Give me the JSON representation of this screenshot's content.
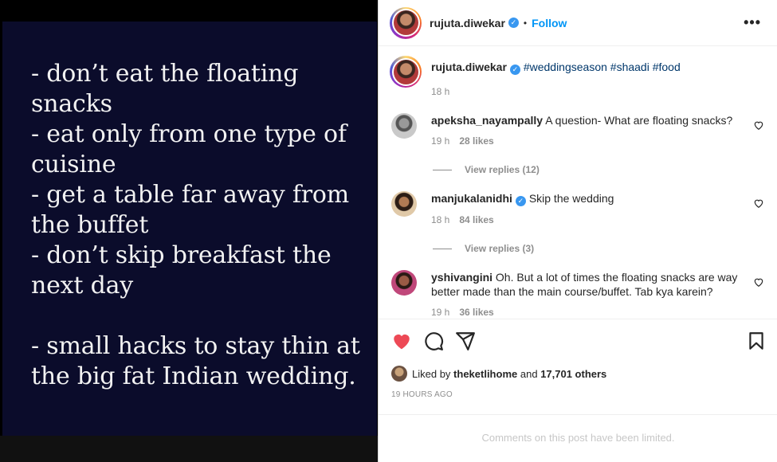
{
  "post_image": {
    "lines": "- don’t eat the floating\nsnacks\n- eat only from one type of\ncuisine\n- get a table far away from\nthe buffet\n- don’t skip breakfast the\nnext day\n\n- small hacks to stay thin at\nthe big fat Indian wedding."
  },
  "header": {
    "username": "rujuta.diwekar",
    "dot": "•",
    "follow_label": "Follow",
    "more_label": "•••"
  },
  "caption": {
    "username": "rujuta.diwekar",
    "text": "#weddingseason #shaadi #food",
    "time": "18 h"
  },
  "comments": [
    {
      "username": "apeksha_nayampally",
      "text": "A question- What are floating snacks?",
      "time": "19 h",
      "likes": "28 likes",
      "replies": "View replies (12)"
    },
    {
      "username": "manjukalanidhi",
      "text": "Skip the wedding",
      "time": "18 h",
      "likes": "84 likes",
      "replies": "View replies (3)"
    },
    {
      "username": "yshivangini",
      "text": "Oh. But a lot of times the floating snacks are way better made than the main course/buffet. Tab kya karein?",
      "time": "19 h",
      "likes": "36 likes"
    }
  ],
  "likes": {
    "prefix": "Liked by",
    "user": "theketlihome",
    "and": "and",
    "count": "17,701 others"
  },
  "timestamp": "19 HOURS AGO",
  "limited_notice": "Comments on this post have been limited.",
  "colors": {
    "accent": "#0095f6",
    "like_red": "#ed4956",
    "image_bg": "#0b0c2b"
  }
}
